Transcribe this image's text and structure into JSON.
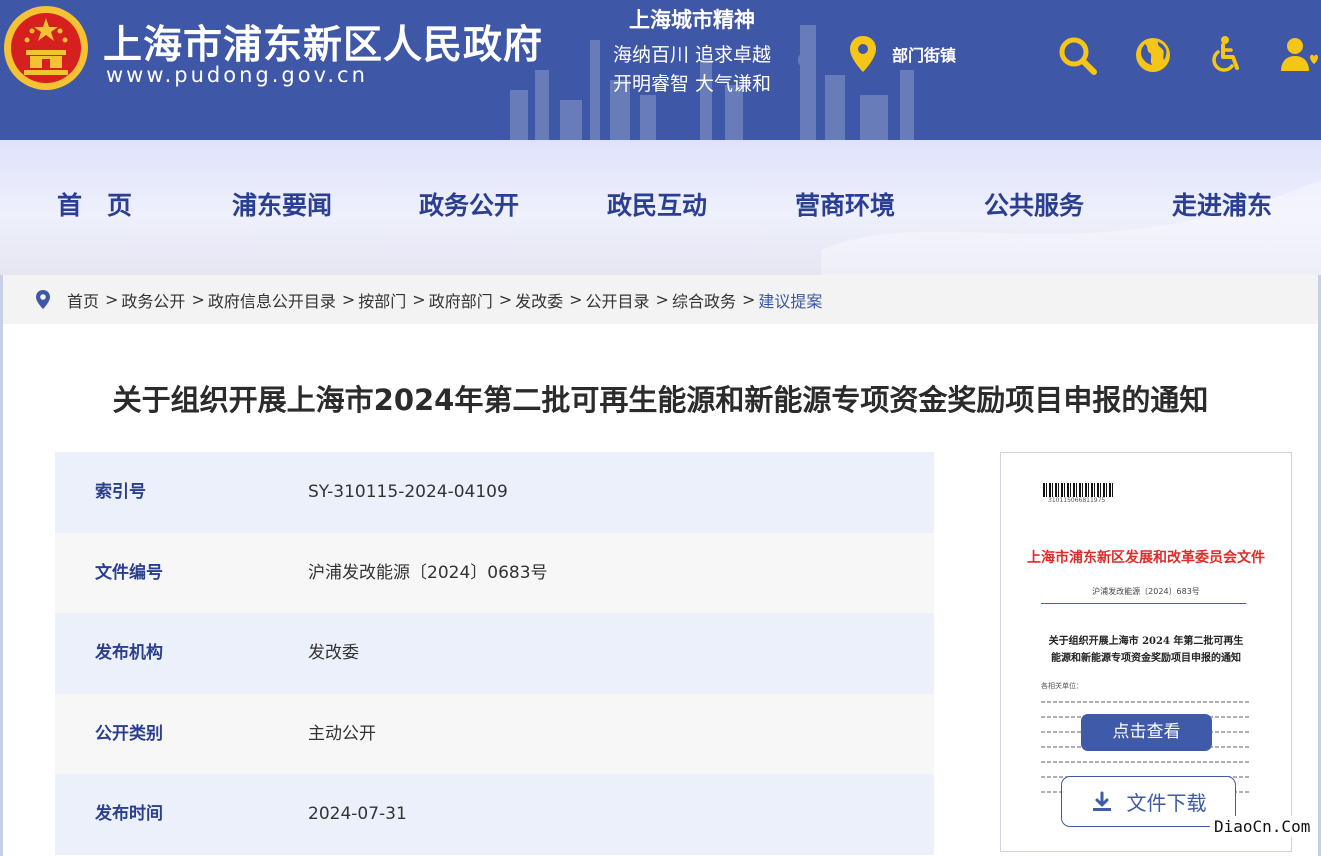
{
  "header": {
    "site_title": "上海市浦东新区人民政府",
    "site_url": "www.pudong.gov.cn",
    "spirit_title": "上海城市精神",
    "spirit_line1": "海纳百川  追求卓越",
    "spirit_line2": "开明睿智  大气谦和",
    "dept_link": "部门街镇",
    "icons": [
      "location-pin-icon",
      "search-icon",
      "globe-icon",
      "accessibility-icon",
      "user-care-icon"
    ],
    "brand_color": "#3f57a7",
    "accent_color": "#f5c518"
  },
  "nav": {
    "items": [
      "首　页",
      "浦东要闻",
      "政务公开",
      "政民互动",
      "营商环境",
      "公共服务",
      "走进浦东"
    ]
  },
  "breadcrumb": {
    "items": [
      "首页",
      "政务公开",
      "政府信息公开目录",
      "按部门",
      "政府部门",
      "发改委",
      "公开目录",
      "综合政务",
      "建议提案"
    ],
    "separator": ">"
  },
  "document": {
    "title": "关于组织开展上海市2024年第二批可再生能源和新能源专项资金奖励项目申报的通知",
    "meta": [
      {
        "label": "索引号",
        "value": "SY-310115-2024-04109"
      },
      {
        "label": "文件编号",
        "value": "沪浦发改能源〔2024〕0683号"
      },
      {
        "label": "发布机构",
        "value": "发改委"
      },
      {
        "label": "公开类别",
        "value": "主动公开"
      },
      {
        "label": "发布时间",
        "value": "2024-07-31"
      }
    ]
  },
  "preview": {
    "barcode_number": "310115066811975",
    "org_header": "上海市浦东新区发展和改革委员会文件",
    "doc_number": "沪浦发改能源〔2024〕683号",
    "title_line1": "关于组织开展上海市 2024 年第二批可再生",
    "title_line2": "能源和新能源专项资金奖励项目申报的通知",
    "salutation": "各相关单位：",
    "view_label": "点击查看",
    "download_label": "文件下载"
  },
  "watermark": "DiaoCn.Com"
}
